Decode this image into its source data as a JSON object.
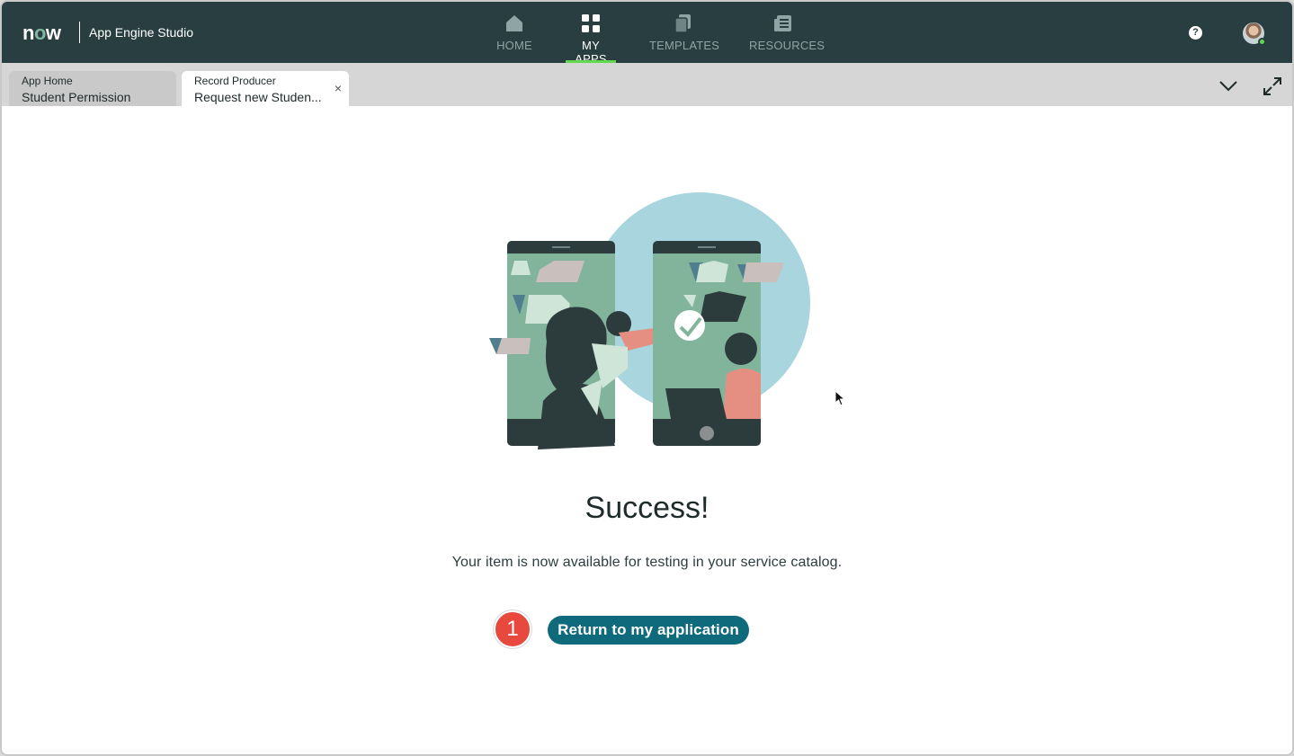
{
  "topbar": {
    "logo_text": "now",
    "app_title": "App Engine Studio",
    "nav": [
      {
        "label": "HOME",
        "icon": "home-icon",
        "active": false
      },
      {
        "label": "MY APPS",
        "icon": "apps-grid-icon",
        "active": true
      },
      {
        "label": "TEMPLATES",
        "icon": "templates-icon",
        "active": false
      },
      {
        "label": "RESOURCES",
        "icon": "resources-icon",
        "active": false
      }
    ],
    "help_glyph": "?",
    "avatar_icon": "user-avatar"
  },
  "tabs": [
    {
      "kicker": "App Home",
      "title": "Student Permission",
      "active": false
    },
    {
      "kicker": "Record Producer",
      "title": "Request new Studen...",
      "active": true,
      "close_glyph": "×"
    }
  ],
  "content": {
    "headline": "Success!",
    "message": "Your item is now available for testing in your service catalog.",
    "step_number": "1",
    "button_label": "Return to my application"
  },
  "colors": {
    "topbar": "#293e40",
    "active_underline": "#62d84e",
    "primary_button": "#0f6b7c",
    "step_badge": "#e8493f",
    "illustration_circle": "#a8d5de",
    "phone_screen": "#82b49c",
    "phone_body": "#2c3c3c"
  }
}
